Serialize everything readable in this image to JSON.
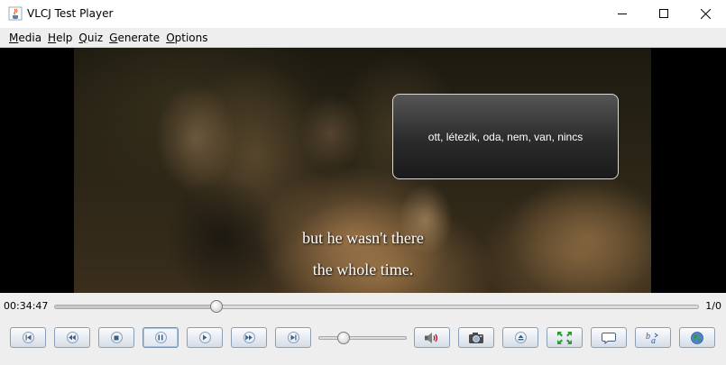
{
  "window": {
    "title": "VLCJ Test Player",
    "icon": "java-cup-icon"
  },
  "menu": [
    {
      "mnemonic": "M",
      "rest": "edia"
    },
    {
      "mnemonic": "H",
      "rest": "elp"
    },
    {
      "mnemonic": "Q",
      "rest": "uiz"
    },
    {
      "mnemonic": "G",
      "rest": "enerate"
    },
    {
      "mnemonic": "O",
      "rest": "ptions"
    }
  ],
  "video": {
    "popup_text": "ott, létezik, oda, nem, van, nincs",
    "subtitle_line1": "but he wasn't there",
    "subtitle_line2": "the whole time."
  },
  "playback": {
    "elapsed": "00:34:47",
    "count": "1/0",
    "position_fraction": 0.252,
    "volume_fraction": 0.29
  },
  "buttons": [
    {
      "name": "previous-chapter-button",
      "icon": "skip-back-icon"
    },
    {
      "name": "rewind-button",
      "icon": "rewind-icon"
    },
    {
      "name": "stop-button",
      "icon": "stop-icon"
    },
    {
      "name": "pause-button",
      "icon": "pause-icon"
    },
    {
      "name": "play-button",
      "icon": "play-icon"
    },
    {
      "name": "fast-forward-button",
      "icon": "fast-forward-icon"
    },
    {
      "name": "next-chapter-button",
      "icon": "skip-forward-icon"
    },
    {
      "name": "mute-button",
      "icon": "speaker-icon"
    },
    {
      "name": "snapshot-button",
      "icon": "camera-icon"
    },
    {
      "name": "eject-button",
      "icon": "eject-icon"
    },
    {
      "name": "fullscreen-button",
      "icon": "fullscreen-icon"
    },
    {
      "name": "subtitles-button",
      "icon": "speech-bubble-icon"
    },
    {
      "name": "translate-button",
      "icon": "translate-icon"
    },
    {
      "name": "web-button",
      "icon": "globe-icon"
    }
  ],
  "colors": {
    "popup_border": "#d9d9d9",
    "button_border": "#8c9eb5",
    "speaker_accent": "#d40000",
    "fullscreen_accent": "#2e9a2e",
    "globe_accent": "#3a9a3a"
  }
}
